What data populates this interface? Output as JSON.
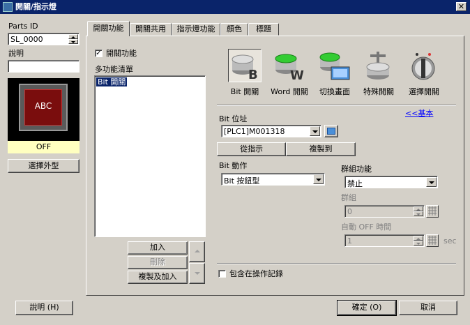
{
  "window": {
    "title": "開關/指示燈",
    "close_glyph": "✕"
  },
  "left": {
    "parts_id_label": "Parts ID",
    "parts_id_value": "SL_0000",
    "comment_label": "說明",
    "comment_value": "",
    "preview_text": "ABC",
    "preview_state": "OFF",
    "select_shape_button": "選擇外型"
  },
  "tabs": [
    {
      "label": "開關功能",
      "active": true
    },
    {
      "label": "開關共用",
      "active": false
    },
    {
      "label": "指示燈功能",
      "active": false
    },
    {
      "label": "顏色",
      "active": false
    },
    {
      "label": "標題",
      "active": false
    }
  ],
  "switch_func": {
    "enable_checkbox_label": "開關功能",
    "enable_checked": true,
    "multi_list_label": "多功能清單",
    "list_items": [
      "Bit 開關"
    ],
    "add_button": "加入",
    "delete_button": "刪除",
    "copy_add_button": "複製及加入"
  },
  "tools": [
    {
      "label": "Bit 開關",
      "icon": "bit-switch-icon"
    },
    {
      "label": "Word 開關",
      "icon": "word-switch-icon"
    },
    {
      "label": "切換畫面",
      "icon": "change-screen-icon"
    },
    {
      "label": "特殊開關",
      "icon": "special-switch-icon"
    },
    {
      "label": "選擇開關",
      "icon": "selector-switch-icon"
    }
  ],
  "basic_link": "<<基本",
  "bit_address": {
    "label": "Bit 位址",
    "value": "[PLC1]M001318",
    "from_indicator_button": "從指示",
    "copy_to_button": "複製到"
  },
  "bit_action": {
    "label": "Bit 動作",
    "value": "Bit 按鈕型"
  },
  "group": {
    "func_label": "群組功能",
    "func_value": "禁止",
    "group_label": "群組",
    "group_value": "0",
    "auto_off_label": "自動 OFF 時間",
    "auto_off_value": "1",
    "unit": "sec"
  },
  "op_log_label": "包含在操作記錄",
  "op_log_checked": false,
  "footer": {
    "help_button": "說明 (H)",
    "ok_button": "確定 (O)",
    "cancel_button": "取消"
  },
  "colors": {
    "title_bar": "#0a246a",
    "preview_bg": "#7a0d0d",
    "state_bg": "#ffffc0",
    "link": "#0000ff"
  }
}
